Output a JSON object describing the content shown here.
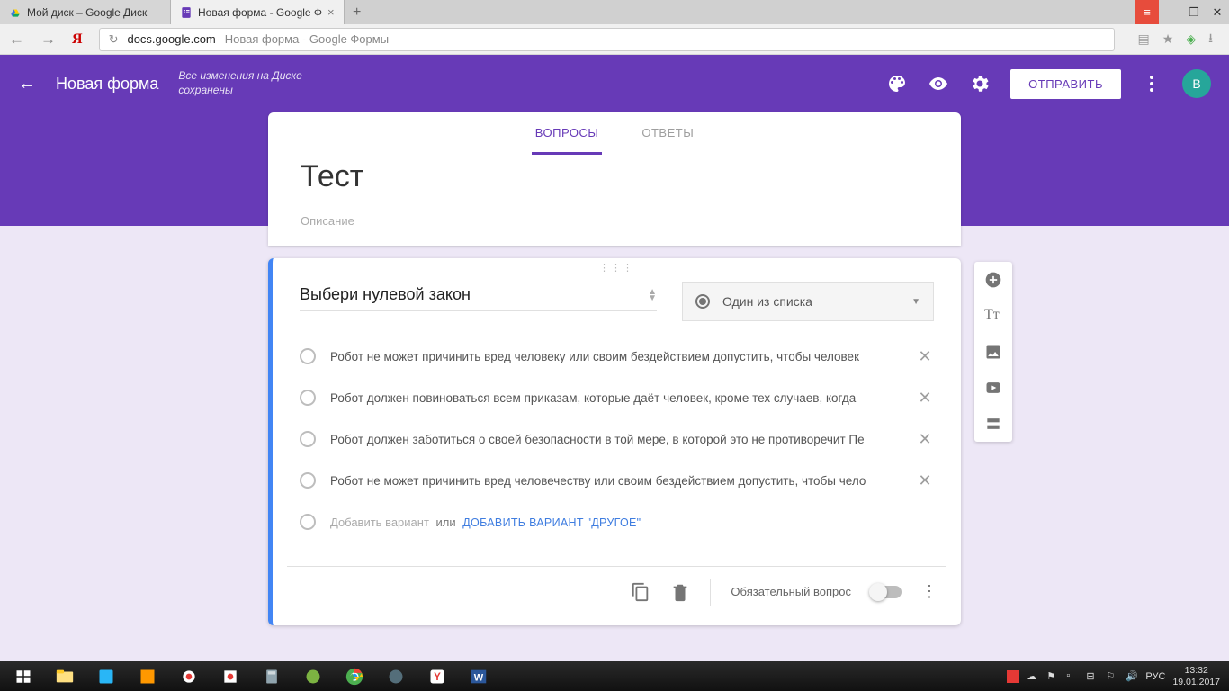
{
  "browser": {
    "tabs": [
      {
        "label": "Мой диск – Google Диск"
      },
      {
        "label": "Новая форма - Google Ф"
      }
    ],
    "url_host": "docs.google.com",
    "url_title": "Новая форма - Google Формы"
  },
  "header": {
    "title": "Новая форма",
    "save_state": "Все изменения на Диске\nсохранены",
    "send_label": "ОТПРАВИТЬ",
    "avatar_letter": "В"
  },
  "form": {
    "tabs": {
      "questions": "ВОПРОСЫ",
      "responses": "ОТВЕТЫ"
    },
    "title": "Тест",
    "description_placeholder": "Описание"
  },
  "question": {
    "title": "Выбери нулевой закон",
    "type_label": "Один из списка",
    "options": [
      "Робот не может причинить вред человеку или своим бездействием допустить, чтобы человек",
      "Робот должен повиноваться всем приказам, которые даёт человек, кроме тех случаев, когда",
      "Робот должен заботиться о своей безопасности в той мере, в которой это не противоречит Пе",
      "Робот не может причинить вред человечеству или своим бездействием допустить, чтобы чело"
    ],
    "add_option": "Добавить вариант",
    "or": "или",
    "add_other": "ДОБАВИТЬ ВАРИАНТ \"ДРУГОЕ\"",
    "required_label": "Обязательный вопрос"
  },
  "taskbar": {
    "lang": "РУС",
    "time": "13:32",
    "date": "19.01.2017"
  }
}
